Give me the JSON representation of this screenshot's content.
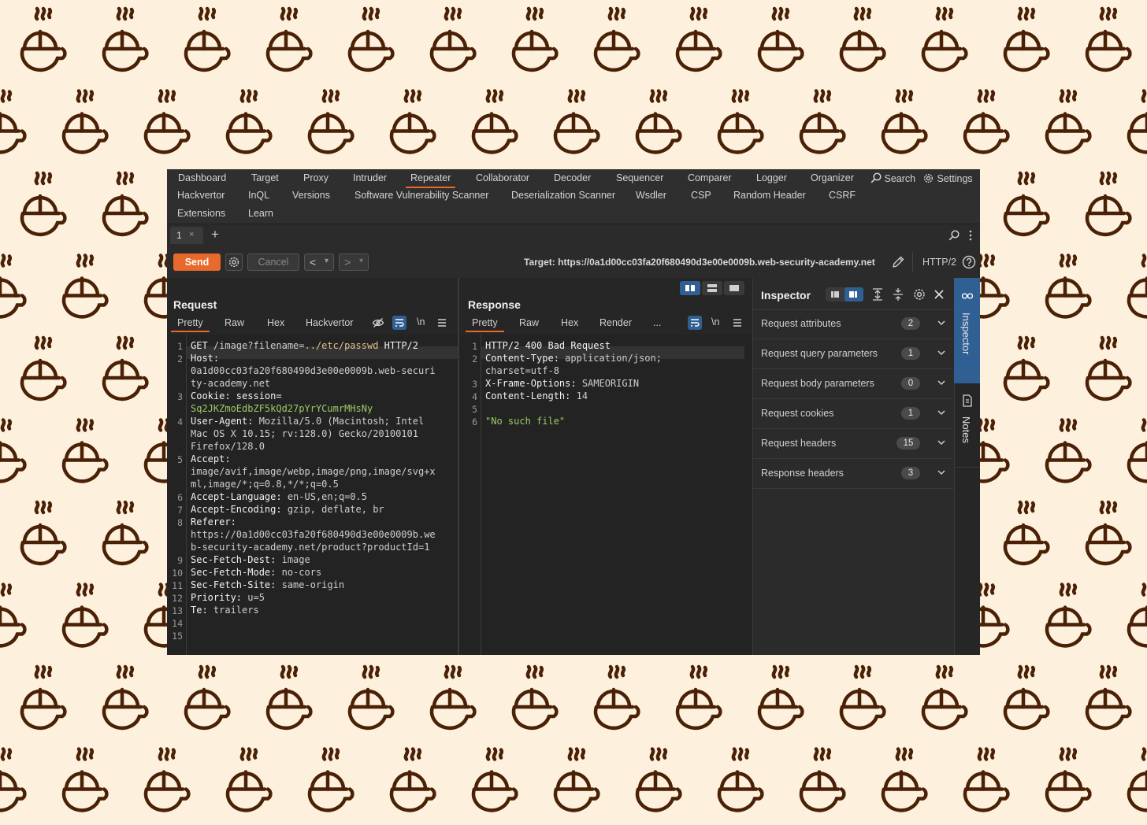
{
  "colors": {
    "accent": "#e8692c",
    "background": "#fdf0dc",
    "pattern": "#4a2106",
    "window": "#2b2b2b",
    "sidebar_active": "#2f5f93"
  },
  "menu": {
    "row1": [
      "Dashboard",
      "Target",
      "Proxy",
      "Intruder",
      "Repeater",
      "Collaborator",
      "Decoder",
      "Sequencer",
      "Comparer",
      "Logger",
      "Organizer"
    ],
    "search_label": "Search",
    "settings_label": "Settings",
    "row2": [
      "Hackvertor",
      "InQL",
      "Versions",
      "Software Vulnerability Scanner",
      "Deserialization Scanner",
      "Wsdler",
      "CSP",
      "Random Header",
      "CSRF"
    ],
    "row3": [
      "Extensions",
      "Learn"
    ],
    "active": "Repeater"
  },
  "tabs": {
    "items": [
      {
        "label": "1",
        "close": "×"
      }
    ],
    "add": "+"
  },
  "toolbar": {
    "send_label": "Send",
    "cancel_label": "Cancel",
    "prev": "<",
    "next": ">",
    "dropdown": "▾",
    "target": "Target: https://0a1d00cc03fa20f680490d3e00e0009b.web-security-academy.net",
    "protocol": "HTTP/2"
  },
  "request": {
    "title": "Request",
    "tabs": [
      "Pretty",
      "Raw",
      "Hex",
      "Hackvertor"
    ],
    "newline": "\\n",
    "line_numbers": [
      "1",
      "2",
      "3",
      "4",
      "5",
      "6",
      "7",
      "8",
      "9",
      "10",
      "11",
      "12",
      "13",
      "14",
      "15"
    ],
    "lines": [
      {
        "n": "1",
        "parts": [
          [
            "GET ",
            "k"
          ],
          [
            "/image?filename=",
            "v"
          ],
          [
            "../etc/passwd",
            "y"
          ],
          [
            " HTTP/2",
            "k"
          ]
        ]
      },
      {
        "n": "2",
        "parts": [
          [
            "Host:",
            "k"
          ]
        ]
      },
      {
        "n": "",
        "parts": [
          [
            "0a1d00cc03fa20f680490d3e00e0009b.web-securi",
            "v"
          ]
        ]
      },
      {
        "n": "",
        "parts": [
          [
            "ty-academy.net",
            "v"
          ]
        ]
      },
      {
        "n": "3",
        "parts": [
          [
            "Cookie: session=",
            "k"
          ]
        ]
      },
      {
        "n": "",
        "parts": [
          [
            "Sq2JKZmoEdbZF5kQd27pYrYCumrMHsNy",
            "g"
          ]
        ]
      },
      {
        "n": "4",
        "parts": [
          [
            "User-Agent:",
            "k"
          ],
          [
            " Mozilla/5.0 (Macintosh; Intel",
            "v"
          ]
        ]
      },
      {
        "n": "",
        "parts": [
          [
            "Mac OS X 10.15; rv:128.0) Gecko/20100101",
            "v"
          ]
        ]
      },
      {
        "n": "",
        "parts": [
          [
            "Firefox/128.0",
            "v"
          ]
        ]
      },
      {
        "n": "5",
        "parts": [
          [
            "Accept:",
            "k"
          ]
        ]
      },
      {
        "n": "",
        "parts": [
          [
            "image/avif,image/webp,image/png,image/svg+x",
            "v"
          ]
        ]
      },
      {
        "n": "",
        "parts": [
          [
            "ml,image/*;q=0.8,*/*;q=0.5",
            "v"
          ]
        ]
      },
      {
        "n": "6",
        "parts": [
          [
            "Accept-Language:",
            "k"
          ],
          [
            " en-US,en;q=0.5",
            "v"
          ]
        ]
      },
      {
        "n": "7",
        "parts": [
          [
            "Accept-Encoding:",
            "k"
          ],
          [
            " gzip, deflate, br",
            "v"
          ]
        ]
      },
      {
        "n": "8",
        "parts": [
          [
            "Referer:",
            "k"
          ]
        ]
      },
      {
        "n": "",
        "parts": [
          [
            "https://0a1d00cc03fa20f680490d3e00e0009b.we",
            "v"
          ]
        ]
      },
      {
        "n": "",
        "parts": [
          [
            "b-security-academy.net/product?productId=1",
            "v"
          ]
        ]
      },
      {
        "n": "9",
        "parts": [
          [
            "Sec-Fetch-Dest:",
            "k"
          ],
          [
            " image",
            "v"
          ]
        ]
      },
      {
        "n": "10",
        "parts": [
          [
            "Sec-Fetch-Mode:",
            "k"
          ],
          [
            " no-cors",
            "v"
          ]
        ]
      },
      {
        "n": "11",
        "parts": [
          [
            "Sec-Fetch-Site:",
            "k"
          ],
          [
            " same-origin",
            "v"
          ]
        ]
      },
      {
        "n": "12",
        "parts": [
          [
            "Priority:",
            "k"
          ],
          [
            " u=5",
            "v"
          ]
        ]
      },
      {
        "n": "13",
        "parts": [
          [
            "Te:",
            "k"
          ],
          [
            " trailers",
            "v"
          ]
        ]
      },
      {
        "n": "14",
        "parts": []
      },
      {
        "n": "15",
        "parts": []
      }
    ]
  },
  "response": {
    "title": "Response",
    "tabs": [
      "Pretty",
      "Raw",
      "Hex",
      "Render",
      "..."
    ],
    "newline": "\\n",
    "lines": [
      {
        "n": "1",
        "parts": [
          [
            "HTTP/2 400 Bad Request",
            "k"
          ]
        ]
      },
      {
        "n": "2",
        "parts": [
          [
            "Content-Type:",
            "k"
          ],
          [
            " application/json;",
            "v"
          ]
        ]
      },
      {
        "n": "",
        "parts": [
          [
            "charset=utf-8",
            "v"
          ]
        ]
      },
      {
        "n": "3",
        "parts": [
          [
            "X-Frame-Options:",
            "k"
          ],
          [
            " SAMEORIGIN",
            "v"
          ]
        ]
      },
      {
        "n": "4",
        "parts": [
          [
            "Content-Length:",
            "k"
          ],
          [
            " 14",
            "v"
          ]
        ]
      },
      {
        "n": "5",
        "parts": []
      },
      {
        "n": "6",
        "parts": [
          [
            "\"No such file\"",
            "g"
          ]
        ]
      }
    ]
  },
  "inspector": {
    "title": "Inspector",
    "rows": [
      {
        "label": "Request attributes",
        "count": "2"
      },
      {
        "label": "Request query parameters",
        "count": "1"
      },
      {
        "label": "Request body parameters",
        "count": "0"
      },
      {
        "label": "Request cookies",
        "count": "1"
      },
      {
        "label": "Request headers",
        "count": "15"
      },
      {
        "label": "Response headers",
        "count": "3"
      }
    ]
  },
  "sidebar": {
    "inspector_label": "Inspector",
    "notes_label": "Notes"
  }
}
